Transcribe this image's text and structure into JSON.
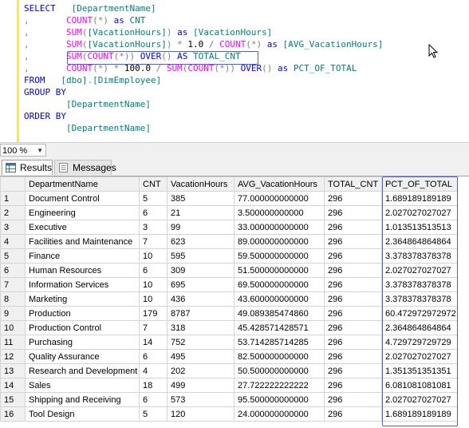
{
  "editor": {
    "lines": [
      [
        {
          "c": "kw",
          "t": "SELECT"
        },
        {
          "c": "tx",
          "t": "   "
        },
        {
          "c": "id",
          "t": "[DepartmentName]"
        }
      ],
      [
        {
          "c": "lead",
          "t": ",       "
        },
        {
          "c": "fn",
          "t": "COUNT"
        },
        {
          "c": "op",
          "t": "(*)"
        },
        {
          "c": "tx",
          "t": " "
        },
        {
          "c": "kw",
          "t": "as"
        },
        {
          "c": "tx",
          "t": " "
        },
        {
          "c": "id",
          "t": "CNT"
        }
      ],
      [
        {
          "c": "lead",
          "t": ",       "
        },
        {
          "c": "fn",
          "t": "SUM"
        },
        {
          "c": "op",
          "t": "("
        },
        {
          "c": "id",
          "t": "[VacationHours]"
        },
        {
          "c": "op",
          "t": ")"
        },
        {
          "c": "tx",
          "t": " "
        },
        {
          "c": "kw",
          "t": "as"
        },
        {
          "c": "tx",
          "t": " "
        },
        {
          "c": "id",
          "t": "[VacationHours]"
        }
      ],
      [
        {
          "c": "lead",
          "t": ",       "
        },
        {
          "c": "fn",
          "t": "SUM"
        },
        {
          "c": "op",
          "t": "("
        },
        {
          "c": "id",
          "t": "[VacationHours]"
        },
        {
          "c": "op",
          "t": ")"
        },
        {
          "c": "tx",
          "t": " "
        },
        {
          "c": "op",
          "t": "*"
        },
        {
          "c": "tx",
          "t": " 1.0 "
        },
        {
          "c": "op",
          "t": "/"
        },
        {
          "c": "tx",
          "t": " "
        },
        {
          "c": "fn",
          "t": "COUNT"
        },
        {
          "c": "op",
          "t": "(*)"
        },
        {
          "c": "tx",
          "t": " "
        },
        {
          "c": "kw",
          "t": "as"
        },
        {
          "c": "tx",
          "t": " "
        },
        {
          "c": "id",
          "t": "[AVG_VacationHours]"
        }
      ],
      [
        {
          "c": "lead",
          "t": ",       "
        },
        {
          "c": "fn",
          "t": "SUM"
        },
        {
          "c": "op",
          "t": "("
        },
        {
          "c": "fn",
          "t": "COUNT"
        },
        {
          "c": "op",
          "t": "(*))"
        },
        {
          "c": "tx",
          "t": " "
        },
        {
          "c": "kw",
          "t": "OVER"
        },
        {
          "c": "op",
          "t": "()"
        },
        {
          "c": "tx",
          "t": " "
        },
        {
          "c": "kw",
          "t": "AS"
        },
        {
          "c": "tx",
          "t": " "
        },
        {
          "c": "id",
          "t": "TOTAL_CNT"
        }
      ],
      [
        {
          "c": "lead",
          "t": ",       "
        },
        {
          "c": "fn",
          "t": "COUNT"
        },
        {
          "c": "op",
          "t": "(*)"
        },
        {
          "c": "tx",
          "t": " "
        },
        {
          "c": "op",
          "t": "*"
        },
        {
          "c": "tx",
          "t": " 100.0 "
        },
        {
          "c": "op",
          "t": "/"
        },
        {
          "c": "tx",
          "t": " "
        },
        {
          "c": "fn",
          "t": "SUM"
        },
        {
          "c": "op",
          "t": "("
        },
        {
          "c": "fn",
          "t": "COUNT"
        },
        {
          "c": "op",
          "t": "(*))"
        },
        {
          "c": "tx",
          "t": " "
        },
        {
          "c": "kw",
          "t": "OVER"
        },
        {
          "c": "op",
          "t": "()"
        },
        {
          "c": "tx",
          "t": " "
        },
        {
          "c": "kw",
          "t": "as"
        },
        {
          "c": "tx",
          "t": " "
        },
        {
          "c": "id",
          "t": "PCT_OF_TOTAL"
        }
      ],
      [
        {
          "c": "kw",
          "t": "FROM"
        },
        {
          "c": "tx",
          "t": "   "
        },
        {
          "c": "id",
          "t": "[dbo]"
        },
        {
          "c": "op",
          "t": "."
        },
        {
          "c": "id",
          "t": "[DimEmployee]"
        }
      ],
      [
        {
          "c": "kw",
          "t": "GROUP BY"
        }
      ],
      [
        {
          "c": "tx",
          "t": "        "
        },
        {
          "c": "id",
          "t": "[DepartmentName]"
        }
      ],
      [
        {
          "c": "kw",
          "t": "ORDER BY"
        }
      ],
      [
        {
          "c": "tx",
          "t": "        "
        },
        {
          "c": "id",
          "t": "[DepartmentName]"
        }
      ]
    ]
  },
  "zoom": {
    "value": "100 %"
  },
  "tabs": {
    "results": "Results",
    "messages": "Messages"
  },
  "grid": {
    "columns": [
      "DepartmentName",
      "CNT",
      "VacationHours",
      "AVG_VacationHours",
      "TOTAL_CNT",
      "PCT_OF_TOTAL"
    ],
    "rows": [
      [
        "1",
        "Document Control",
        "5",
        "385",
        "77.000000000000",
        "296",
        "1.689189189189"
      ],
      [
        "2",
        "Engineering",
        "6",
        "21",
        "3.500000000000",
        "296",
        "2.027027027027"
      ],
      [
        "3",
        "Executive",
        "3",
        "99",
        "33.000000000000",
        "296",
        "1.013513513513"
      ],
      [
        "4",
        "Facilities and Maintenance",
        "7",
        "623",
        "89.000000000000",
        "296",
        "2.364864864864"
      ],
      [
        "5",
        "Finance",
        "10",
        "595",
        "59.500000000000",
        "296",
        "3.378378378378"
      ],
      [
        "6",
        "Human Resources",
        "6",
        "309",
        "51.500000000000",
        "296",
        "2.027027027027"
      ],
      [
        "7",
        "Information Services",
        "10",
        "695",
        "69.500000000000",
        "296",
        "3.378378378378"
      ],
      [
        "8",
        "Marketing",
        "10",
        "436",
        "43.600000000000",
        "296",
        "3.378378378378"
      ],
      [
        "9",
        "Production",
        "179",
        "8787",
        "49.089385474860",
        "296",
        "60.472972972972"
      ],
      [
        "10",
        "Production Control",
        "7",
        "318",
        "45.428571428571",
        "296",
        "2.364864864864"
      ],
      [
        "11",
        "Purchasing",
        "14",
        "752",
        "53.714285714285",
        "296",
        "4.729729729729"
      ],
      [
        "12",
        "Quality Assurance",
        "6",
        "495",
        "82.500000000000",
        "296",
        "2.027027027027"
      ],
      [
        "13",
        "Research and Development",
        "4",
        "202",
        "50.500000000000",
        "296",
        "1.351351351351"
      ],
      [
        "14",
        "Sales",
        "18",
        "499",
        "27.722222222222",
        "296",
        "6.081081081081"
      ],
      [
        "15",
        "Shipping and Receiving",
        "6",
        "573",
        "95.500000000000",
        "296",
        "2.027027027027"
      ],
      [
        "16",
        "Tool Design",
        "5",
        "120",
        "24.000000000000",
        "296",
        "1.689189189189"
      ]
    ]
  }
}
